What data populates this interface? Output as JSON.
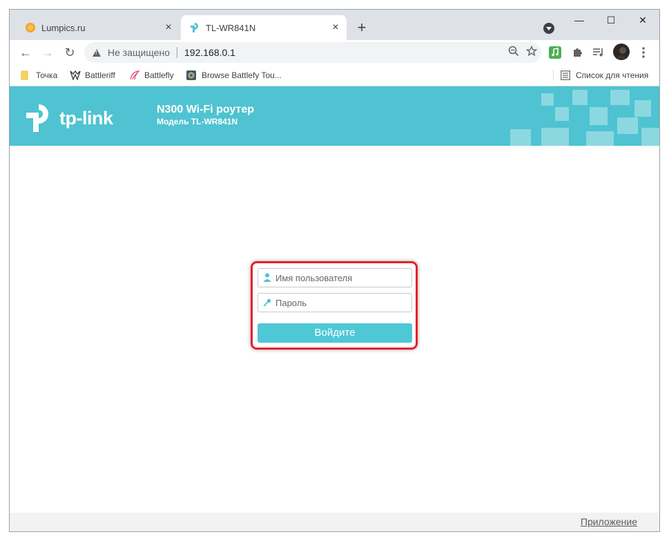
{
  "tabs": [
    {
      "title": "Lumpics.ru",
      "close": "×"
    },
    {
      "title": "TL-WR841N",
      "close": "×"
    }
  ],
  "new_tab": "+",
  "window_controls": {
    "minimize": "—",
    "maximize": "☐",
    "close": "✕"
  },
  "toolbar": {
    "back": "←",
    "forward": "→",
    "reload": "↻",
    "security_label": "Не защищено",
    "url": "192.168.0.1"
  },
  "bookmarks": [
    {
      "label": "Точка"
    },
    {
      "label": "Battleriff"
    },
    {
      "label": "Battlefly"
    },
    {
      "label": "Browse Battlefy Tou..."
    }
  ],
  "reading_list": "Список для чтения",
  "page": {
    "logo_text": "tp-link",
    "model_title": "N300 Wi-Fi роутер",
    "model_subtitle": "Модель TL-WR841N",
    "username_placeholder": "Имя пользователя",
    "password_placeholder": "Пароль",
    "login_button": "Войдите",
    "footer_link": "Приложение"
  },
  "colors": {
    "brand": "#4fc3d1",
    "login_button": "#4fc8d6",
    "highlight_frame": "#e6202a",
    "tabstrip": "#dee1e6"
  },
  "icons": [
    "lumpics-favicon",
    "tplink-favicon",
    "close-icon",
    "plus-icon",
    "back-icon",
    "forward-icon",
    "reload-icon",
    "warning-icon",
    "zoom-icon",
    "star-icon",
    "music-extension-icon",
    "puzzle-icon",
    "media-queue-icon",
    "avatar",
    "kebab-menu-icon",
    "folder-icon",
    "reading-list-icon",
    "user-icon",
    "key-icon"
  ]
}
